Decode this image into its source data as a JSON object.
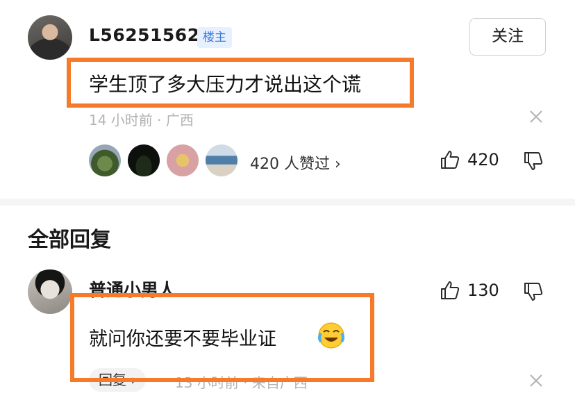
{
  "comment": {
    "username": "L56251562",
    "op_badge": "楼主",
    "follow_label": "关注",
    "text": "学生顶了多大压力才说出这个谎",
    "time": "14 小时前 · 广西",
    "likers_summary": "420 人赞过 ›",
    "like_count": "420"
  },
  "replies": {
    "section_title": "全部回复",
    "items": [
      {
        "username": "普通小男人",
        "text": "就问你还要不要毕业证",
        "emoji": "laughing-crying-emoji",
        "like_count": "130",
        "reply_label": "回复 ›",
        "meta": "13 小时前 · 来自广西"
      }
    ]
  },
  "colors": {
    "highlight": "#f57a2a",
    "badge_bg": "#e6f0ff",
    "badge_text": "#3b7bd9",
    "meta_gray": "#b3b3b3"
  },
  "icons": [
    "thumb-up-icon",
    "thumb-down-icon",
    "close-icon"
  ]
}
